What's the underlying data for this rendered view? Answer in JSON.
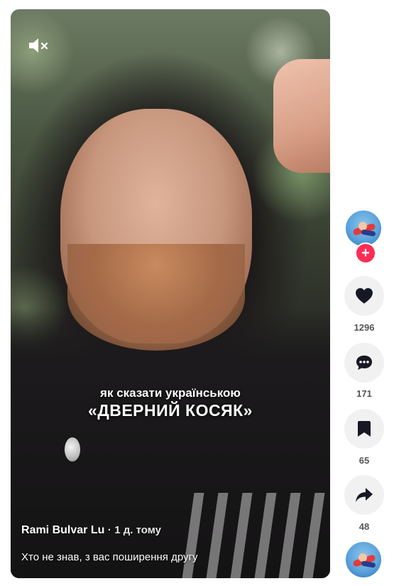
{
  "video": {
    "caption_line1": "як сказати українською",
    "caption_line2": "«ДВЕРНИЙ КОСЯК»",
    "author": "Rami Bulvar Lu",
    "separator": "·",
    "time_ago": "1 д. тому",
    "description": "Хто не знав, з вас поширення другу"
  },
  "actions": {
    "like_count": "1296",
    "comment_count": "171",
    "save_count": "65",
    "share_count": "48"
  },
  "icons": {
    "mute": "speaker-muted-icon",
    "follow": "plus-icon",
    "like": "heart-icon",
    "comment": "comment-bubble-icon",
    "save": "bookmark-icon",
    "share": "share-arrow-icon"
  },
  "colors": {
    "follow_badge": "#fe2c55",
    "action_bg": "#f1f1f2",
    "count_text": "#555555"
  }
}
